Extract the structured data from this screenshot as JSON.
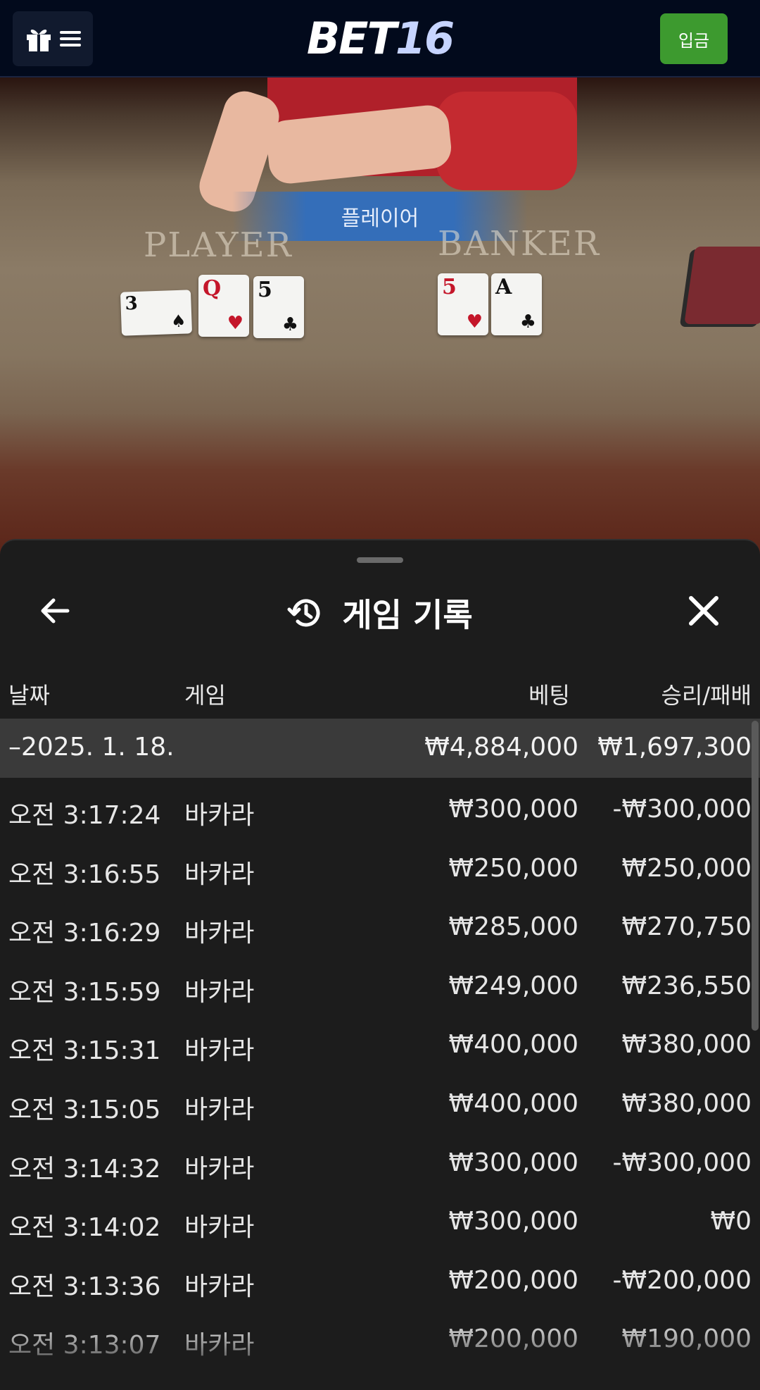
{
  "header": {
    "logo_part1": "BET",
    "logo_part2": "16",
    "deposit_label": "입금"
  },
  "video": {
    "result_banner": "플레이어",
    "player_label": "PLAYER",
    "banker_label": "BANKER",
    "player_cards": [
      {
        "rank": "3",
        "suit": "♠"
      },
      {
        "rank": "Q",
        "suit": "♥"
      },
      {
        "rank": "5",
        "suit": "♣"
      }
    ],
    "banker_cards": [
      {
        "rank": "5",
        "suit": "♥"
      },
      {
        "rank": "A",
        "suit": "♣"
      }
    ]
  },
  "panel": {
    "title": "게임 기록",
    "columns": {
      "date": "날짜",
      "game": "게임",
      "bet": "베팅",
      "result": "승리/패배"
    },
    "summary": {
      "date": "–2025. 1. 18.",
      "bet": "₩4,884,000",
      "result": "₩1,697,300"
    },
    "rows": [
      {
        "time": "오전 3:17:24",
        "game": "바카라",
        "bet": "₩300,000",
        "result": "-₩300,000"
      },
      {
        "time": "오전 3:16:55",
        "game": "바카라",
        "bet": "₩250,000",
        "result": "₩250,000"
      },
      {
        "time": "오전 3:16:29",
        "game": "바카라",
        "bet": "₩285,000",
        "result": "₩270,750"
      },
      {
        "time": "오전 3:15:59",
        "game": "바카라",
        "bet": "₩249,000",
        "result": "₩236,550"
      },
      {
        "time": "오전 3:15:31",
        "game": "바카라",
        "bet": "₩400,000",
        "result": "₩380,000"
      },
      {
        "time": "오전 3:15:05",
        "game": "바카라",
        "bet": "₩400,000",
        "result": "₩380,000"
      },
      {
        "time": "오전 3:14:32",
        "game": "바카라",
        "bet": "₩300,000",
        "result": "-₩300,000"
      },
      {
        "time": "오전 3:14:02",
        "game": "바카라",
        "bet": "₩300,000",
        "result": "₩0"
      },
      {
        "time": "오전 3:13:36",
        "game": "바카라",
        "bet": "₩200,000",
        "result": "-₩200,000"
      },
      {
        "time": "오전 3:13:07",
        "game": "바카라",
        "bet": "₩200,000",
        "result": "₩190,000"
      }
    ]
  },
  "icons": {
    "menu": "gift-menu-icon",
    "back": "arrow-left-icon",
    "history": "history-clock-icon",
    "close": "close-icon"
  },
  "colors": {
    "header_bg": "#020a1c",
    "deposit_green": "#3d9a2f",
    "panel_bg": "#1c1c1c",
    "summary_bg": "#3a3a3a",
    "banner_blue": "#306ebe"
  }
}
